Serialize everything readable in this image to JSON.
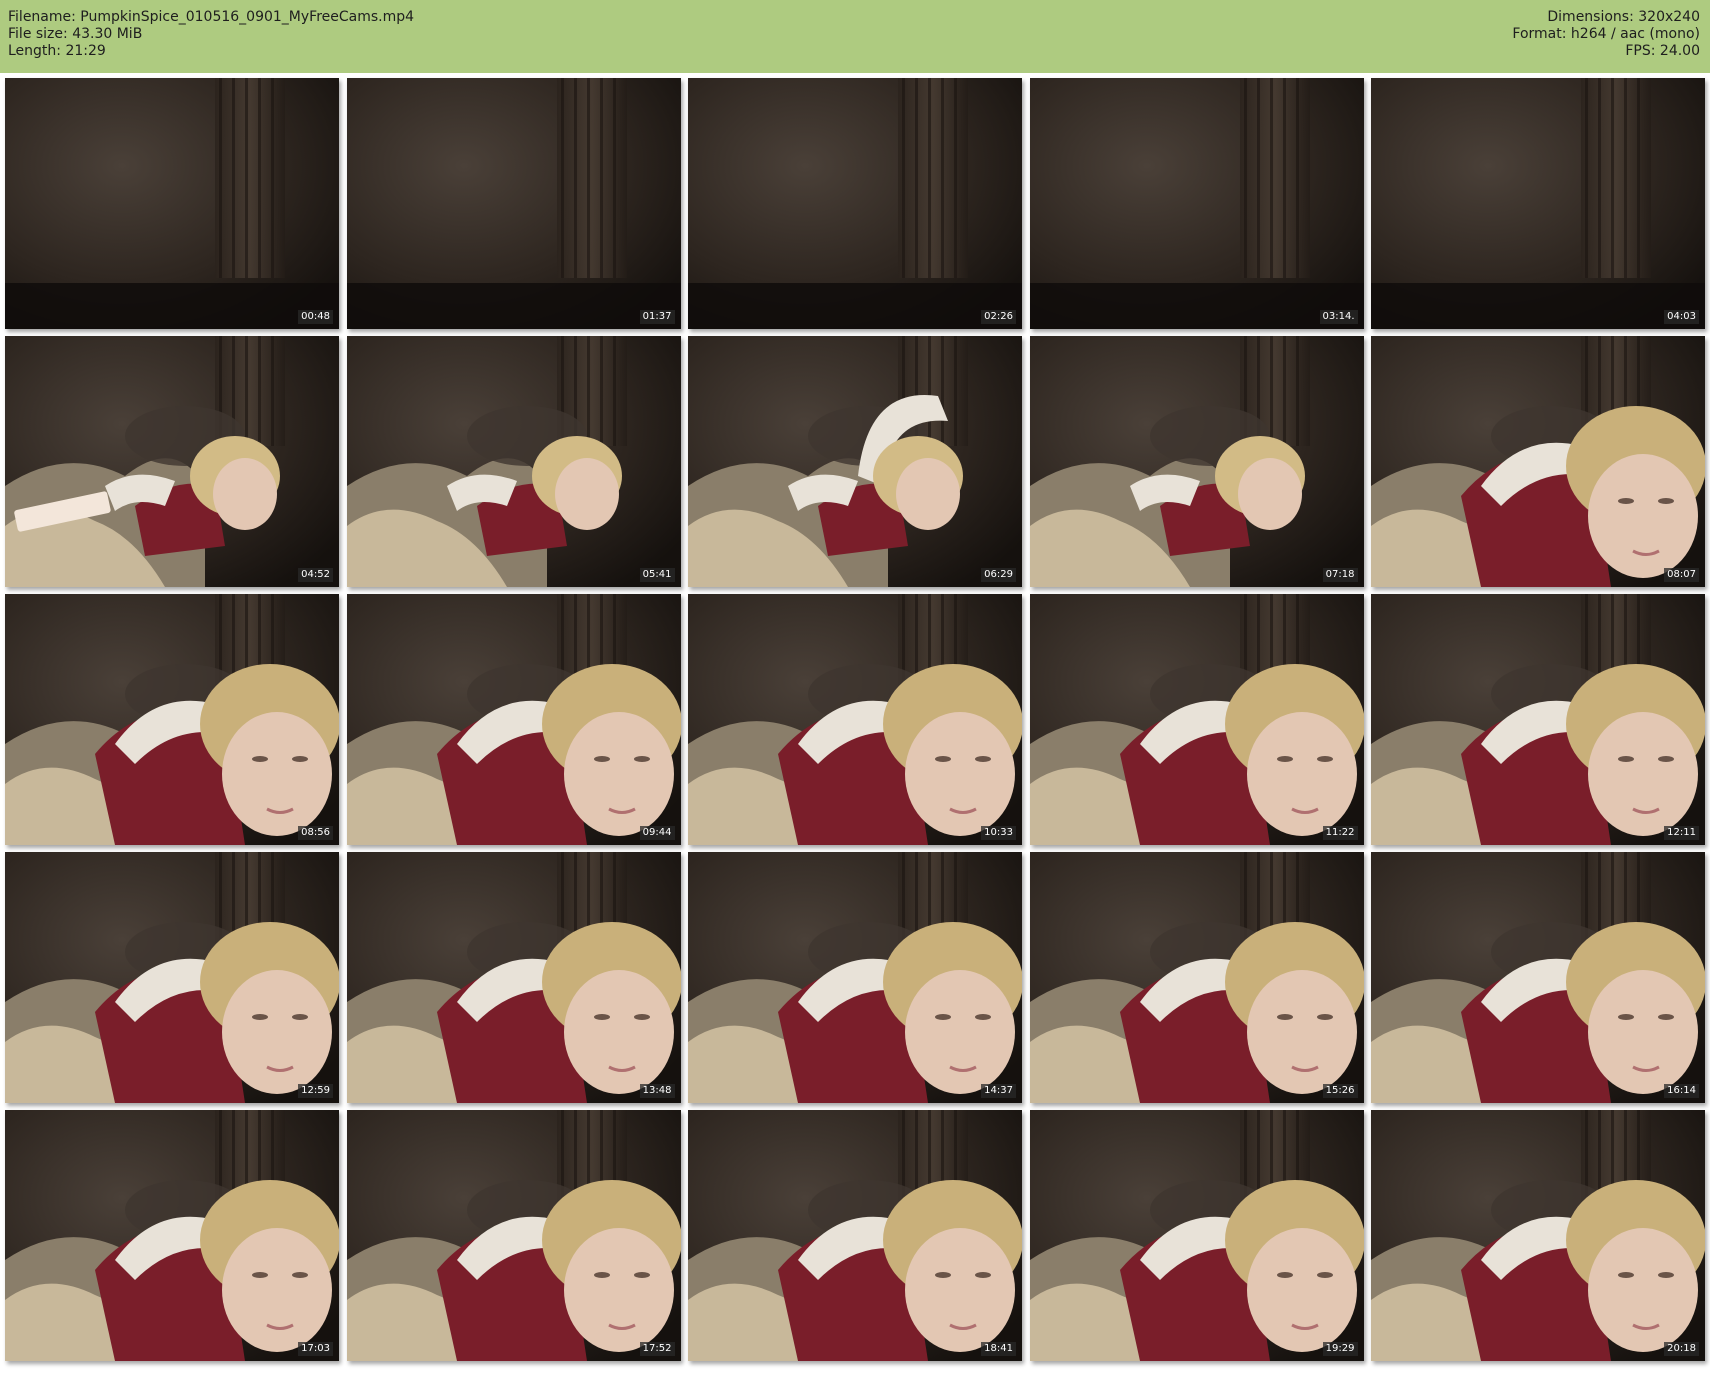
{
  "header": {
    "filename": "Filename: PumpkinSpice_010516_0901_MyFreeCams.mp4",
    "file_size": "File size: 43.30 MiB",
    "length": "Length: 21:29",
    "dimensions": "Dimensions: 320x240",
    "format": "Format: h264 / aac (mono)",
    "fps": "FPS: 24.00"
  },
  "colors": {
    "header_bg": "#aecb80",
    "jacket": "#7a1e2a",
    "room_dark": "#2a221c"
  },
  "thumbnails": [
    {
      "time": "00:48",
      "scene": "empty"
    },
    {
      "time": "01:37",
      "scene": "empty"
    },
    {
      "time": "02:26",
      "scene": "empty"
    },
    {
      "time": "03:14.",
      "scene": "empty"
    },
    {
      "time": "04:03",
      "scene": "empty"
    },
    {
      "time": "04:52",
      "scene": "phone"
    },
    {
      "time": "05:41",
      "scene": "lying"
    },
    {
      "time": "06:29",
      "scene": "arm-up"
    },
    {
      "time": "07:18",
      "scene": "lying"
    },
    {
      "time": "08:07",
      "scene": "close"
    },
    {
      "time": "08:56",
      "scene": "close"
    },
    {
      "time": "09:44",
      "scene": "close"
    },
    {
      "time": "10:33",
      "scene": "close"
    },
    {
      "time": "11:22",
      "scene": "close"
    },
    {
      "time": "12:11",
      "scene": "close"
    },
    {
      "time": "12:59",
      "scene": "close"
    },
    {
      "time": "13:48",
      "scene": "close"
    },
    {
      "time": "14:37",
      "scene": "close"
    },
    {
      "time": "15:26",
      "scene": "close"
    },
    {
      "time": "16:14",
      "scene": "close"
    },
    {
      "time": "17:03",
      "scene": "close"
    },
    {
      "time": "17:52",
      "scene": "close"
    },
    {
      "time": "18:41",
      "scene": "close"
    },
    {
      "time": "19:29",
      "scene": "close"
    },
    {
      "time": "20:18",
      "scene": "close"
    }
  ]
}
